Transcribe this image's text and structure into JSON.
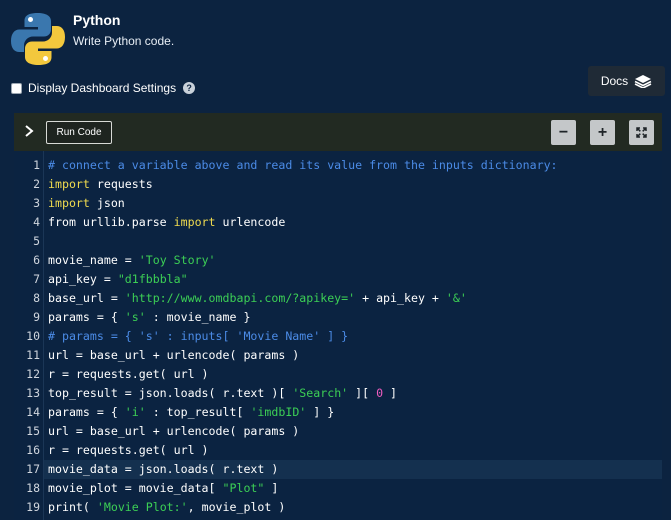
{
  "app": {
    "title": "Python",
    "subtitle": "Write Python code.",
    "logo_icon": "python-logo"
  },
  "settings": {
    "label": "Display Dashboard Settings",
    "checked": false,
    "help_icon": "question-circle-icon"
  },
  "docs": {
    "label": "Docs",
    "icon": "book-icon"
  },
  "toolbar": {
    "run_label": "Run Code",
    "expand_icon": "chevron-right-icon",
    "zoom_out_label": "−",
    "zoom_in_label": "+",
    "fullscreen_icon": "expand-icon"
  },
  "colors": {
    "background": "#0c2340",
    "toolbar": "#222a22",
    "keyword": "#f0db4f",
    "string": "#3ccf55",
    "number": "#ef5cbf",
    "comment": "#4b8be6"
  },
  "code": {
    "highlighted_line": 17,
    "lines": [
      {
        "n": "1",
        "tokens": [
          [
            "# connect a variable above and read its value from the inputs dictionary:",
            "cmt"
          ]
        ]
      },
      {
        "n": "2",
        "tokens": [
          [
            "import",
            "kw"
          ],
          [
            " requests",
            ""
          ]
        ]
      },
      {
        "n": "3",
        "tokens": [
          [
            "import",
            "kw"
          ],
          [
            " json",
            ""
          ]
        ]
      },
      {
        "n": "4",
        "tokens": [
          [
            "from urllib.parse ",
            ""
          ],
          [
            "import",
            "kw"
          ],
          [
            " urlencode",
            ""
          ]
        ]
      },
      {
        "n": "5",
        "tokens": []
      },
      {
        "n": "6",
        "tokens": [
          [
            "movie_name = ",
            ""
          ],
          [
            "'Toy Story'",
            "str"
          ]
        ]
      },
      {
        "n": "7",
        "tokens": [
          [
            "api_key = ",
            ""
          ],
          [
            "\"d1fbbbla\"",
            "str"
          ]
        ]
      },
      {
        "n": "8",
        "tokens": [
          [
            "base_url = ",
            ""
          ],
          [
            "'http://www.omdbapi.com/?apikey='",
            "str"
          ],
          [
            " + api_key + ",
            ""
          ],
          [
            "'&'",
            "str"
          ]
        ]
      },
      {
        "n": "9",
        "tokens": [
          [
            "params = { ",
            ""
          ],
          [
            "'s'",
            "str"
          ],
          [
            " : movie_name }",
            ""
          ]
        ]
      },
      {
        "n": "10",
        "tokens": [
          [
            "# params = { 's' : inputs[ 'Movie Name' ] }",
            "cmt"
          ]
        ]
      },
      {
        "n": "11",
        "tokens": [
          [
            "url = base_url + urlencode( params )",
            ""
          ]
        ]
      },
      {
        "n": "12",
        "tokens": [
          [
            "r = requests.get( url )",
            ""
          ]
        ]
      },
      {
        "n": "13",
        "tokens": [
          [
            "top_result = json.loads( r.text )[ ",
            ""
          ],
          [
            "'Search'",
            "str"
          ],
          [
            " ][ ",
            ""
          ],
          [
            "0",
            "num"
          ],
          [
            " ]",
            ""
          ]
        ]
      },
      {
        "n": "14",
        "tokens": [
          [
            "params = { ",
            ""
          ],
          [
            "'i'",
            "str"
          ],
          [
            " : top_result[ ",
            ""
          ],
          [
            "'imdbID'",
            "str"
          ],
          [
            " ] }",
            ""
          ]
        ]
      },
      {
        "n": "15",
        "tokens": [
          [
            "url = base_url + urlencode( params )",
            ""
          ]
        ]
      },
      {
        "n": "16",
        "tokens": [
          [
            "r = requests.get( url )",
            ""
          ]
        ]
      },
      {
        "n": "17",
        "tokens": [
          [
            "movie_data = json.loads( r.text )",
            ""
          ]
        ]
      },
      {
        "n": "18",
        "tokens": [
          [
            "movie_plot = movie_data[ ",
            ""
          ],
          [
            "\"Plot\"",
            "str"
          ],
          [
            " ]",
            ""
          ]
        ]
      },
      {
        "n": "19",
        "tokens": [
          [
            "print( ",
            ""
          ],
          [
            "'Movie Plot:'",
            "str"
          ],
          [
            ", movie_plot )",
            ""
          ]
        ]
      }
    ]
  }
}
